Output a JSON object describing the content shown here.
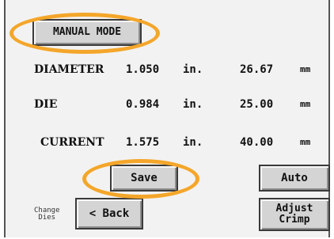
{
  "header": {
    "mode_label": "MANUAL MODE"
  },
  "rows": [
    {
      "label": "DIAMETER",
      "in_value": "1.050",
      "in_unit": "in.",
      "mm_value": "26.67",
      "mm_unit": "mm"
    },
    {
      "label": "DIE",
      "in_value": "0.984",
      "in_unit": "in.",
      "mm_value": "25.00",
      "mm_unit": "mm"
    },
    {
      "label": "CURRENT",
      "in_value": "1.575",
      "in_unit": "in.",
      "mm_value": "40.00",
      "mm_unit": "mm"
    }
  ],
  "buttons": {
    "save": "Save",
    "auto": "Auto",
    "back": "< Back",
    "adjust_crimp": "Adjust\nCrimp"
  },
  "side_label": "Change\nDies",
  "colors": {
    "highlight": "#f4a62a",
    "button_face": "#d4d4d4",
    "screen_bg": "#f2f2f2"
  }
}
